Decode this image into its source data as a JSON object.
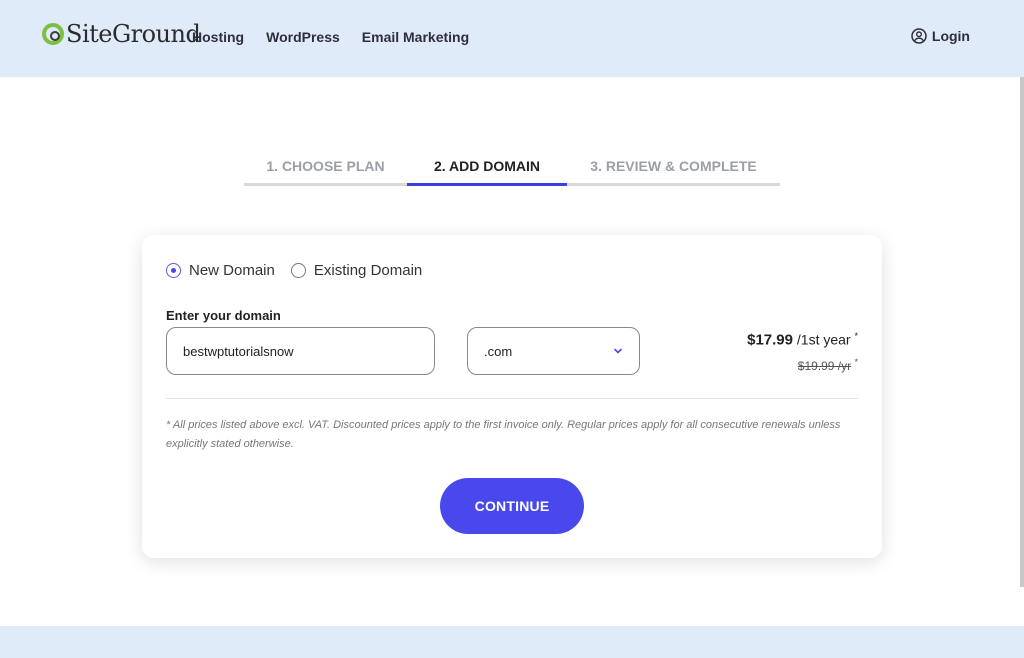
{
  "header": {
    "logo_text": "SiteGround",
    "nav": [
      "Hosting",
      "WordPress",
      "Email Marketing"
    ],
    "login_label": "Login"
  },
  "steps": [
    {
      "label": "1. CHOOSE PLAN",
      "state": "done"
    },
    {
      "label": "2. ADD DOMAIN",
      "state": "active"
    },
    {
      "label": "3. REVIEW & COMPLETE",
      "state": "pending"
    }
  ],
  "domain_form": {
    "options": [
      {
        "label": "New Domain",
        "checked": true
      },
      {
        "label": "Existing Domain",
        "checked": false
      }
    ],
    "field_label": "Enter your domain",
    "domain_value": "bestwptutorialsnow",
    "tld_selected": ".com",
    "price_current": "$17.99",
    "price_period": "/1st year",
    "price_regular": "$19.99 /yr",
    "asterisk": "*",
    "note": "* All prices listed above excl. VAT. Discounted prices apply to the first invoice only. Regular prices apply for all consecutive renewals unless explicitly stated otherwise.",
    "continue_label": "CONTINUE"
  },
  "colors": {
    "header_bg": "#e0ebfa",
    "accent": "#4848ec",
    "logo_green": "#7ac142"
  }
}
